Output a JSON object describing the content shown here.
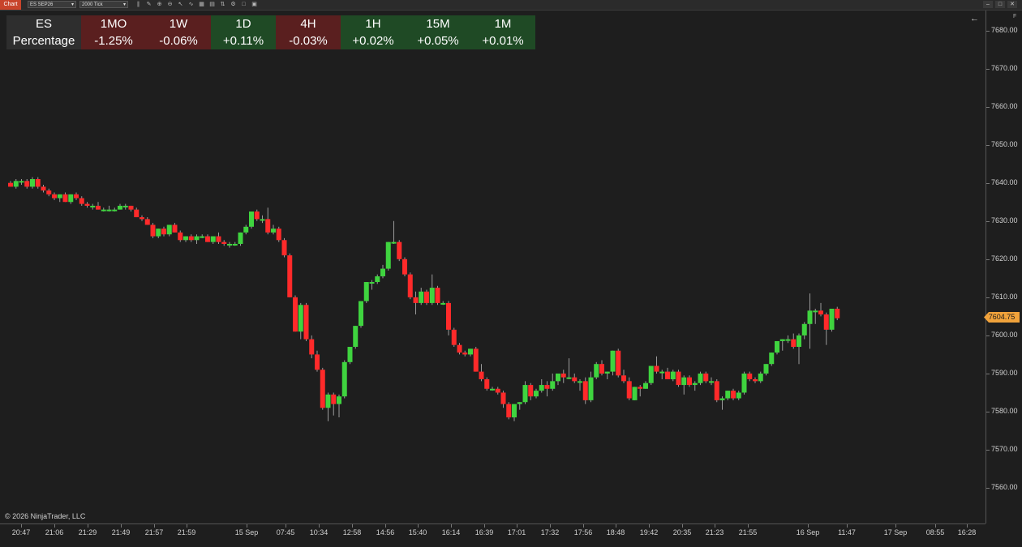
{
  "toolbar": {
    "title": "Chart",
    "instrument": "ES SEP26",
    "interval": "2000 Tick",
    "window_buttons": [
      "–",
      "□",
      "✕"
    ]
  },
  "panel": {
    "symbol": "ES",
    "row_label": "Percentage",
    "columns": [
      {
        "period": "1MO",
        "value": "-1.25%",
        "color": "#5a1f1f"
      },
      {
        "period": "1W",
        "value": "-0.06%",
        "color": "#5a1f1f"
      },
      {
        "period": "1D",
        "value": "+0.11%",
        "color": "#1f4a25"
      },
      {
        "period": "4H",
        "value": "-0.03%",
        "color": "#5a1f1f"
      },
      {
        "period": "1H",
        "value": "+0.02%",
        "color": "#1f4a25"
      },
      {
        "period": "15M",
        "value": "+0.05%",
        "color": "#1f4a25"
      },
      {
        "period": "1M",
        "value": "+0.01%",
        "color": "#1f4a25"
      }
    ],
    "header_color": "#2e2e2e"
  },
  "price_axis": {
    "labels": [
      "7680.00",
      "7670.00",
      "7660.00",
      "7650.00",
      "7640.00",
      "7630.00",
      "7620.00",
      "7610.00",
      "7600.00",
      "7590.00",
      "7580.00",
      "7570.00",
      "7560.00"
    ],
    "current_price": "7604.75",
    "current_color": "#f0a23b"
  },
  "time_axis": {
    "labels": [
      "20:47",
      "21:06",
      "21:29",
      "21:49",
      "21:57",
      "21:59",
      "15 Sep",
      "07:45",
      "10:34",
      "12:58",
      "14:56",
      "15:40",
      "16:14",
      "16:39",
      "17:01",
      "17:32",
      "17:56",
      "18:48",
      "19:42",
      "20:35",
      "21:23",
      "21:55",
      "16 Sep",
      "11:47",
      "17 Sep",
      "08:55",
      "16:28"
    ]
  },
  "copyright": "© 2026 NinjaTrader, LLC",
  "colors": {
    "up": "#3fd43f",
    "down": "#ff2a2a",
    "wick": "#9a9a9a"
  },
  "chart_data": {
    "type": "candlestick",
    "ylim": [
      7555,
      7685
    ],
    "candles": [
      [
        7640.0,
        7640.5,
        7639.0,
        7639.0
      ],
      [
        7639.0,
        7641.0,
        7638.5,
        7640.5
      ],
      [
        7640.5,
        7641.0,
        7639.5,
        7640.5
      ],
      [
        7640.5,
        7641.0,
        7638.5,
        7639.0
      ],
      [
        7639.0,
        7641.5,
        7638.5,
        7641.0
      ],
      [
        7641.0,
        7641.5,
        7638.5,
        7639.0
      ],
      [
        7639.0,
        7639.5,
        7637.5,
        7638.0
      ],
      [
        7638.0,
        7638.5,
        7636.5,
        7637.0
      ],
      [
        7637.0,
        7637.5,
        7635.5,
        7636.0
      ],
      [
        7636.0,
        7637.0,
        7635.0,
        7637.0
      ],
      [
        7637.0,
        7637.5,
        7635.0,
        7635.0
      ],
      [
        7635.0,
        7637.0,
        7634.5,
        7637.0
      ],
      [
        7637.0,
        7637.5,
        7635.5,
        7636.0
      ],
      [
        7636.0,
        7636.5,
        7634.0,
        7634.5
      ],
      [
        7634.5,
        7635.0,
        7633.5,
        7634.0
      ],
      [
        7634.0,
        7634.5,
        7633.0,
        7634.0
      ],
      [
        7634.0,
        7635.0,
        7633.0,
        7633.0
      ],
      [
        7633.0,
        7633.5,
        7632.5,
        7633.0
      ],
      [
        7633.0,
        7634.0,
        7632.5,
        7633.0
      ],
      [
        7633.0,
        7633.5,
        7632.5,
        7633.0
      ],
      [
        7633.0,
        7634.5,
        7633.0,
        7634.0
      ],
      [
        7634.0,
        7634.5,
        7633.0,
        7634.0
      ],
      [
        7634.0,
        7634.0,
        7632.5,
        7633.0
      ],
      [
        7633.0,
        7633.5,
        7631.0,
        7631.0
      ],
      [
        7631.0,
        7631.5,
        7630.0,
        7630.5
      ],
      [
        7630.5,
        7631.0,
        7629.0,
        7629.0
      ],
      [
        7629.0,
        7629.5,
        7625.5,
        7626.0
      ],
      [
        7626.0,
        7628.0,
        7625.5,
        7628.0
      ],
      [
        7628.0,
        7628.5,
        7626.0,
        7626.5
      ],
      [
        7626.5,
        7629.0,
        7626.0,
        7629.0
      ],
      [
        7629.0,
        7629.5,
        7627.0,
        7627.0
      ],
      [
        7627.0,
        7627.5,
        7624.5,
        7625.0
      ],
      [
        7625.0,
        7626.0,
        7624.5,
        7626.0
      ],
      [
        7626.0,
        7626.5,
        7624.5,
        7625.0
      ],
      [
        7625.0,
        7626.5,
        7624.0,
        7626.0
      ],
      [
        7626.0,
        7626.5,
        7625.5,
        7626.0
      ],
      [
        7626.0,
        7626.5,
        7624.5,
        7624.5
      ],
      [
        7624.5,
        7626.0,
        7624.0,
        7626.0
      ],
      [
        7626.0,
        7627.0,
        7624.0,
        7624.5
      ],
      [
        7624.5,
        7625.0,
        7623.5,
        7624.0
      ],
      [
        7624.0,
        7624.5,
        7623.0,
        7624.0
      ],
      [
        7624.0,
        7624.5,
        7623.5,
        7624.0
      ],
      [
        7624.0,
        7627.0,
        7623.5,
        7627.0
      ],
      [
        7627.0,
        7629.0,
        7626.5,
        7628.5
      ],
      [
        7628.5,
        7632.5,
        7628.0,
        7632.5
      ],
      [
        7632.5,
        7633.0,
        7630.0,
        7630.5
      ],
      [
        7630.5,
        7631.5,
        7629.5,
        7630.5
      ],
      [
        7630.5,
        7633.5,
        7626.5,
        7627.0
      ],
      [
        7627.0,
        7629.0,
        7626.5,
        7628.0
      ],
      [
        7628.0,
        7628.5,
        7624.5,
        7625.0
      ],
      [
        7625.0,
        7625.5,
        7620.5,
        7621.0
      ],
      [
        7621.0,
        7621.5,
        7610.0,
        7610.0
      ],
      [
        7610.0,
        7610.5,
        7601.0,
        7601.0
      ],
      [
        7601.0,
        7608.5,
        7599.0,
        7608.0
      ],
      [
        7608.0,
        7608.5,
        7598.5,
        7599.0
      ],
      [
        7599.0,
        7600.0,
        7594.0,
        7595.0
      ],
      [
        7595.0,
        7596.0,
        7590.5,
        7591.0
      ],
      [
        7591.0,
        7591.5,
        7580.5,
        7581.0
      ],
      [
        7581.0,
        7585.0,
        7577.5,
        7584.5
      ],
      [
        7584.5,
        7585.0,
        7579.0,
        7582.0
      ],
      [
        7582.0,
        7584.5,
        7578.5,
        7584.0
      ],
      [
        7584.0,
        7593.5,
        7583.5,
        7593.0
      ],
      [
        7593.0,
        7597.0,
        7592.5,
        7597.0
      ],
      [
        7597.0,
        7602.5,
        7596.5,
        7602.5
      ],
      [
        7602.5,
        7609.0,
        7602.0,
        7609.0
      ],
      [
        7609.0,
        7614.0,
        7608.5,
        7614.0
      ],
      [
        7614.0,
        7614.5,
        7612.0,
        7614.0
      ],
      [
        7614.0,
        7616.0,
        7613.5,
        7615.5
      ],
      [
        7615.5,
        7618.5,
        7615.0,
        7617.5
      ],
      [
        7617.5,
        7624.5,
        7617.0,
        7624.5
      ],
      [
        7624.5,
        7630.0,
        7624.0,
        7624.5
      ],
      [
        7624.5,
        7625.0,
        7619.5,
        7620.0
      ],
      [
        7620.0,
        7620.5,
        7615.5,
        7616.0
      ],
      [
        7616.0,
        7616.5,
        7609.5,
        7610.0
      ],
      [
        7610.0,
        7611.5,
        7605.5,
        7608.5
      ],
      [
        7608.5,
        7612.5,
        7608.0,
        7611.5
      ],
      [
        7611.5,
        7612.0,
        7608.0,
        7608.5
      ],
      [
        7608.5,
        7616.0,
        7608.0,
        7612.5
      ],
      [
        7612.5,
        7613.0,
        7608.0,
        7608.5
      ],
      [
        7608.5,
        7609.0,
        7608.0,
        7608.5
      ],
      [
        7608.5,
        7609.0,
        7600.0,
        7601.5
      ],
      [
        7601.5,
        7602.0,
        7597.0,
        7597.5
      ],
      [
        7597.5,
        7598.0,
        7595.0,
        7595.5
      ],
      [
        7595.5,
        7596.0,
        7594.5,
        7595.0
      ],
      [
        7595.0,
        7596.5,
        7594.5,
        7596.5
      ],
      [
        7596.5,
        7597.0,
        7590.5,
        7590.5
      ],
      [
        7590.5,
        7592.5,
        7588.0,
        7588.5
      ],
      [
        7588.5,
        7589.0,
        7585.5,
        7586.0
      ],
      [
        7586.0,
        7586.5,
        7585.5,
        7586.0
      ],
      [
        7586.0,
        7586.5,
        7584.5,
        7585.0
      ],
      [
        7585.0,
        7585.5,
        7581.0,
        7582.0
      ],
      [
        7582.0,
        7582.5,
        7578.0,
        7578.5
      ],
      [
        7578.5,
        7582.0,
        7577.5,
        7582.0
      ],
      [
        7582.0,
        7582.5,
        7580.5,
        7582.5
      ],
      [
        7582.5,
        7588.0,
        7582.0,
        7587.0
      ],
      [
        7587.0,
        7587.5,
        7583.0,
        7584.0
      ],
      [
        7584.0,
        7586.0,
        7583.5,
        7585.5
      ],
      [
        7585.5,
        7588.5,
        7585.0,
        7587.0
      ],
      [
        7587.0,
        7588.0,
        7584.0,
        7586.0
      ],
      [
        7586.0,
        7590.0,
        7585.5,
        7588.0
      ],
      [
        7588.0,
        7590.0,
        7587.0,
        7590.0
      ],
      [
        7590.0,
        7591.0,
        7587.5,
        7589.0
      ],
      [
        7589.0,
        7594.0,
        7588.5,
        7589.0
      ],
      [
        7589.0,
        7590.0,
        7587.5,
        7588.0
      ],
      [
        7588.0,
        7588.5,
        7585.5,
        7588.0
      ],
      [
        7588.0,
        7589.0,
        7582.0,
        7583.0
      ],
      [
        7583.0,
        7590.5,
        7582.5,
        7589.0
      ],
      [
        7589.0,
        7593.0,
        7588.5,
        7592.5
      ],
      [
        7592.5,
        7593.5,
        7589.5,
        7590.0
      ],
      [
        7590.0,
        7590.5,
        7588.5,
        7590.5
      ],
      [
        7590.5,
        7596.0,
        7589.5,
        7596.0
      ],
      [
        7596.0,
        7596.5,
        7589.0,
        7589.5
      ],
      [
        7589.5,
        7591.0,
        7587.5,
        7588.0
      ],
      [
        7588.0,
        7589.0,
        7583.0,
        7583.5
      ],
      [
        7583.0,
        7586.5,
        7583.0,
        7586.5
      ],
      [
        7586.5,
        7587.0,
        7584.0,
        7586.0
      ],
      [
        7586.0,
        7588.0,
        7586.0,
        7587.5
      ],
      [
        7587.5,
        7592.0,
        7587.0,
        7592.0
      ],
      [
        7592.0,
        7594.5,
        7590.0,
        7590.5
      ],
      [
        7590.5,
        7591.0,
        7588.5,
        7590.5
      ],
      [
        7590.5,
        7591.5,
        7588.5,
        7588.5
      ],
      [
        7588.5,
        7591.0,
        7588.0,
        7590.5
      ],
      [
        7590.5,
        7591.0,
        7586.5,
        7587.0
      ],
      [
        7587.0,
        7589.5,
        7584.5,
        7589.0
      ],
      [
        7589.0,
        7589.5,
        7586.5,
        7587.0
      ],
      [
        7587.0,
        7588.0,
        7585.5,
        7587.5
      ],
      [
        7587.5,
        7590.5,
        7587.0,
        7590.0
      ],
      [
        7590.0,
        7590.5,
        7587.5,
        7588.0
      ],
      [
        7588.0,
        7589.0,
        7587.0,
        7588.0
      ],
      [
        7588.0,
        7588.5,
        7582.5,
        7583.0
      ],
      [
        7583.0,
        7584.0,
        7580.5,
        7583.5
      ],
      [
        7583.5,
        7585.5,
        7583.0,
        7585.5
      ],
      [
        7585.5,
        7586.0,
        7583.0,
        7583.5
      ],
      [
        7583.5,
        7585.5,
        7583.0,
        7585.0
      ],
      [
        7585.0,
        7590.5,
        7584.5,
        7590.0
      ],
      [
        7590.0,
        7590.5,
        7588.0,
        7588.5
      ],
      [
        7588.5,
        7589.0,
        7587.5,
        7588.0
      ],
      [
        7588.0,
        7590.5,
        7587.5,
        7590.0
      ],
      [
        7590.0,
        7592.5,
        7589.5,
        7592.5
      ],
      [
        7592.5,
        7595.5,
        7592.0,
        7595.5
      ],
      [
        7595.5,
        7598.5,
        7595.0,
        7598.5
      ],
      [
        7598.5,
        7599.0,
        7596.0,
        7599.0
      ],
      [
        7599.0,
        7600.0,
        7598.0,
        7599.0
      ],
      [
        7599.0,
        7600.5,
        7596.5,
        7597.0
      ],
      [
        7597.0,
        7600.5,
        7592.5,
        7600.0
      ],
      [
        7600.0,
        7603.5,
        7599.0,
        7603.0
      ],
      [
        7603.0,
        7611.0,
        7596.5,
        7606.5
      ],
      [
        7606.5,
        7607.0,
        7603.0,
        7606.5
      ],
      [
        7606.5,
        7608.5,
        7605.0,
        7605.5
      ],
      [
        7605.5,
        7606.0,
        7597.5,
        7601.5
      ],
      [
        7601.5,
        7607.0,
        7601.0,
        7607.0
      ],
      [
        7607.0,
        7607.5,
        7604.0,
        7604.5
      ]
    ]
  }
}
